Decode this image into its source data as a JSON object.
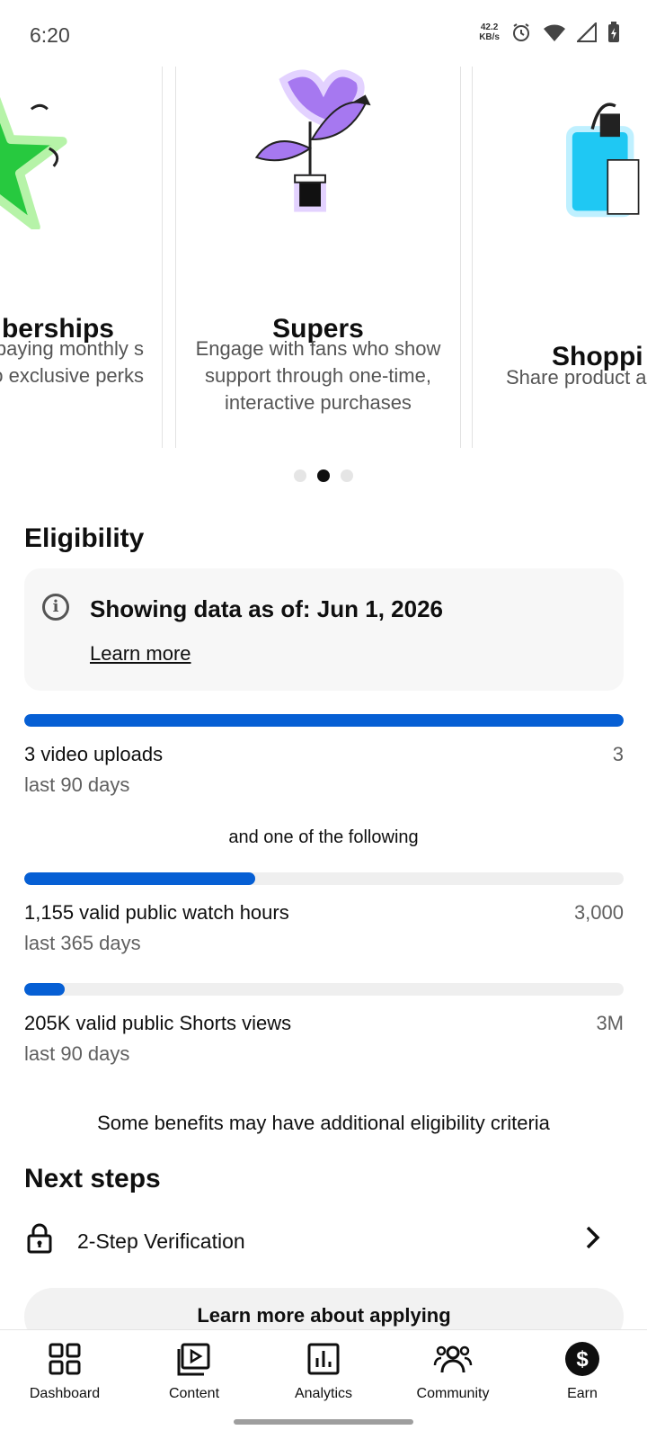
{
  "status_bar": {
    "time": "6:20",
    "net_speed_value": "42.2",
    "net_speed_unit": "KB/s"
  },
  "carousel": {
    "cards": [
      {
        "title": "berships",
        "desc": "a fan club of paying monthly s to exclusive perks"
      },
      {
        "title": "Supers",
        "desc": "Engage with fans who show support through one-time, interactive purchases"
      },
      {
        "title": "Shoppi",
        "desc": "Share product and help viewe"
      }
    ],
    "active_index": 1
  },
  "eligibility": {
    "title": "Eligibility",
    "info_text": "Showing data as of: Jun 1, 2026",
    "learn_more": "Learn more",
    "requirements": [
      {
        "label": "3 video uploads",
        "sub": "last 90 days",
        "target": "3",
        "progress": 1.0
      },
      {
        "label": "1,155 valid public watch hours",
        "sub": "last 365 days",
        "target": "3,000",
        "progress": 0.385
      },
      {
        "label": "205K valid public Shorts views",
        "sub": "last 90 days",
        "target": "3M",
        "progress": 0.068
      }
    ],
    "or_text": "and one of the following",
    "benefits_note": "Some benefits may have additional eligibility criteria"
  },
  "next_steps": {
    "title": "Next steps",
    "items": [
      {
        "label": "2-Step Verification"
      }
    ]
  },
  "apply_button": "Learn more about applying",
  "bottom_nav": {
    "items": [
      {
        "label": "Dashboard",
        "icon": "dashboard-icon"
      },
      {
        "label": "Content",
        "icon": "content-icon"
      },
      {
        "label": "Analytics",
        "icon": "analytics-icon"
      },
      {
        "label": "Community",
        "icon": "community-icon"
      },
      {
        "label": "Earn",
        "icon": "earn-icon"
      }
    ],
    "active": "Earn"
  },
  "colors": {
    "progress_fill": "#065fd4",
    "progress_track": "#efefef",
    "text_primary": "#0f0f0f",
    "text_secondary": "#606060"
  }
}
